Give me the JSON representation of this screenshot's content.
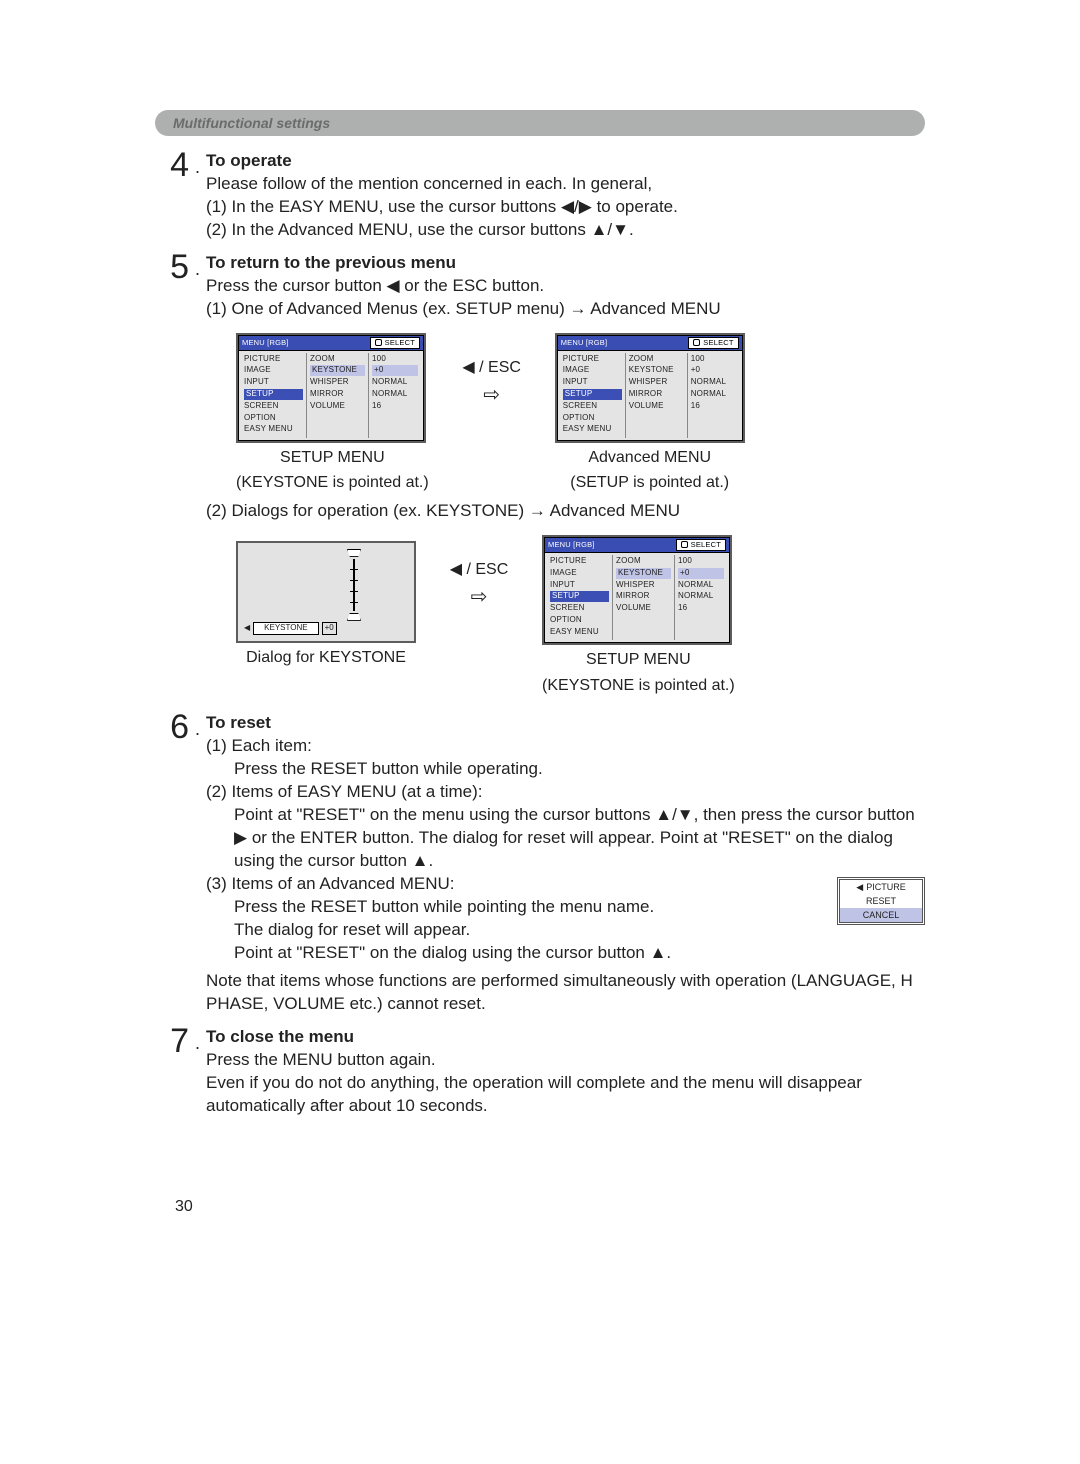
{
  "section_tab": "Multifunctional settings",
  "steps": {
    "s4": {
      "num": "4",
      "title": "To operate",
      "line": "Please follow of the mention concerned in each. In general,",
      "sub1": "(1) In the EASY MENU, use the cursor buttons ◀/▶ to operate.",
      "sub2": "(2) In the Advanced MENU, use the cursor buttons ▲/▼."
    },
    "s5": {
      "num": "5",
      "title": "To return to the previous menu",
      "line": "Press the cursor button ◀ or the ESC button.",
      "sub1": "(1) One of Advanced Menus (ex. SETUP menu) → Advanced MENU",
      "sub2": "(2) Dialogs for operation (ex. KEYSTONE) → Advanced MENU"
    },
    "s6": {
      "num": "6",
      "title": "To reset",
      "l1": "(1) Each item:",
      "l1a": "Press the RESET button while operating.",
      "l2": "(2) Items of EASY MENU (at a time):",
      "l2a": "Point at \"RESET\" on the menu using the cursor buttons ▲/▼, then press the cursor button ▶ or the ENTER button. The dialog for reset will appear. Point at \"RESET\" on the dialog using the cursor button ▲.",
      "l3": "(3) Items of an Advanced MENU:",
      "l3a": "Press the RESET button while pointing the menu name.",
      "l3b": "The dialog for reset will appear.",
      "l3c": "Point at \"RESET\" on the dialog using the cursor button ▲.",
      "note": "Note that items whose functions are performed simultaneously with operation (LANGUAGE, H PHASE, VOLUME etc.) cannot reset."
    },
    "s7": {
      "num": "7",
      "title": "To close the menu",
      "l1": "Press the MENU button again.",
      "l2": "Even if you do not do anything, the operation will complete and the menu will disappear automatically after about 10 seconds."
    }
  },
  "osd": {
    "title": "MENU [RGB]",
    "select": "SELECT",
    "left": [
      "PICTURE",
      "IMAGE",
      "INPUT",
      "SETUP",
      "SCREEN",
      "OPTION",
      "EASY MENU"
    ],
    "mid": [
      "ZOOM",
      "KEYSTONE",
      "WHISPER",
      "MIRROR",
      "VOLUME"
    ],
    "right": [
      "100",
      "+0",
      "NORMAL",
      "NORMAL",
      "16"
    ]
  },
  "esc": "◀ / ESC",
  "captions": {
    "setup_menu": "SETUP MENU",
    "key_pointed": "(KEYSTONE is pointed at.)",
    "adv_menu": "Advanced MENU",
    "setup_pointed": "(SETUP is pointed at.)",
    "dlg_key": "Dialog for KEYSTONE"
  },
  "keystone": {
    "label": "KEYSTONE",
    "value": "+0"
  },
  "reset_dialog": {
    "top": "PICTURE",
    "mid": "RESET",
    "bot": "CANCEL"
  },
  "page_number": "30"
}
